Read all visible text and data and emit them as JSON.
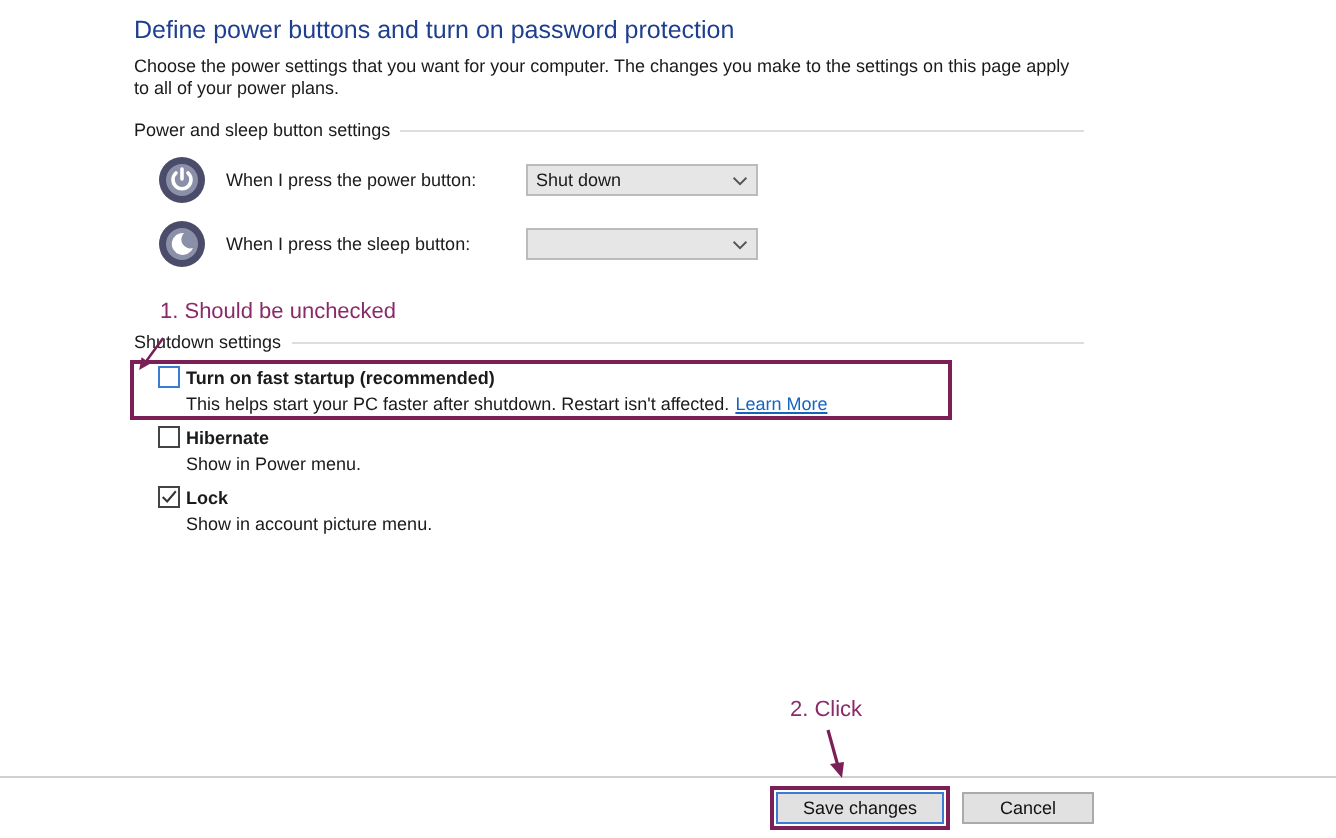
{
  "title": "Define power buttons and turn on password protection",
  "description": "Choose the power settings that you want for your computer. The changes you make to the settings on this page apply to all of your power plans.",
  "button_section": {
    "heading": "Power and sleep button settings",
    "rows": [
      {
        "kind": "power",
        "label": "When I press the power button:",
        "value": "Shut down"
      },
      {
        "kind": "sleep",
        "label": "When I press the sleep button:",
        "value": ""
      }
    ]
  },
  "shutdown_section": {
    "heading": "Shutdown settings",
    "options": [
      {
        "label": "Turn on fast startup (recommended)",
        "description": "This helps start your PC faster after shutdown. Restart isn't affected.",
        "link": "Learn More",
        "checked": false,
        "highlighted": true
      },
      {
        "label": "Hibernate",
        "description": "Show in Power menu.",
        "checked": false,
        "highlighted": false
      },
      {
        "label": "Lock",
        "description": "Show in account picture menu.",
        "checked": true,
        "highlighted": false
      }
    ]
  },
  "buttons": [
    {
      "label": "Save changes",
      "default": true,
      "highlighted": true
    },
    {
      "label": "Cancel",
      "default": false,
      "highlighted": false
    }
  ],
  "annotations": [
    {
      "text": "1. Should be unchecked"
    },
    {
      "text": "2. Click"
    }
  ]
}
